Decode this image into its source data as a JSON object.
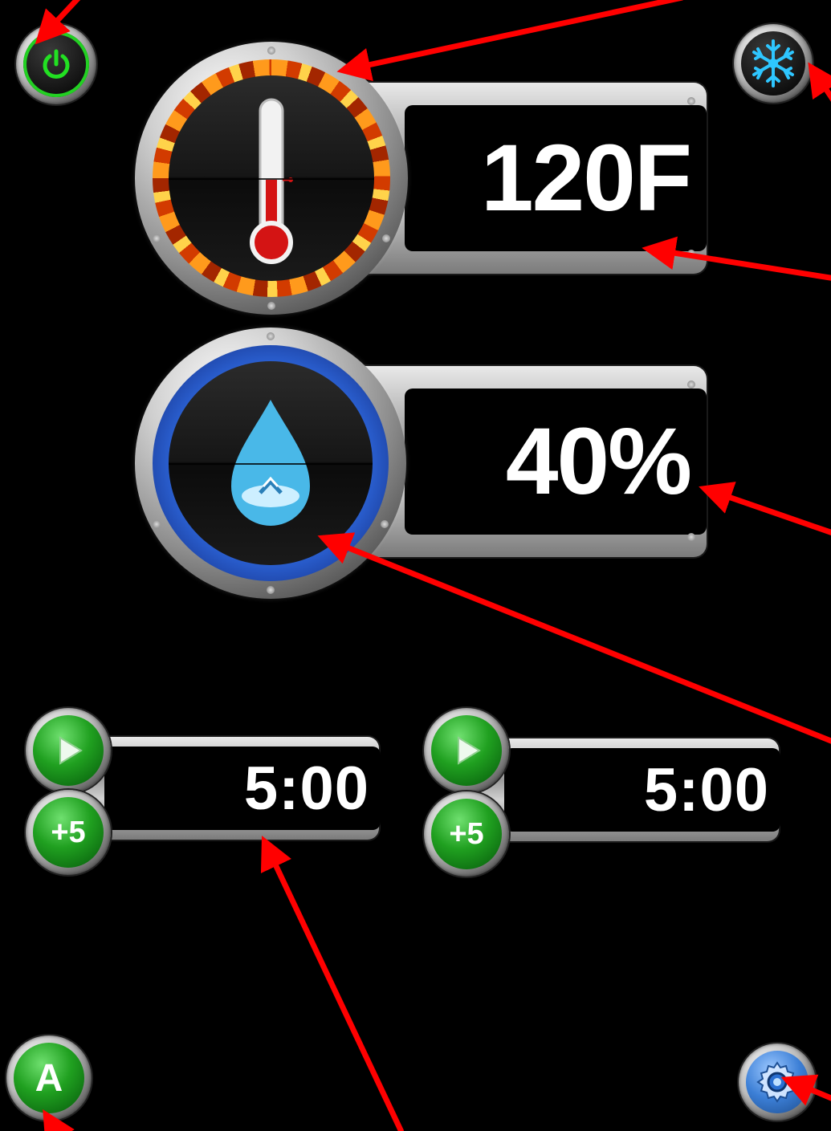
{
  "temperature": {
    "value": "120F"
  },
  "humidity": {
    "value": "40%"
  },
  "timers": [
    {
      "time": "5:00",
      "add_label": "+5"
    },
    {
      "time": "5:00",
      "add_label": "+5"
    }
  ],
  "auto_button": {
    "label": "A"
  },
  "icons": {
    "power": "power-icon",
    "cool": "snowflake-icon",
    "settings": "gear-icon",
    "thermometer": "thermometer-icon",
    "water": "water-drop-icon",
    "play": "play-icon"
  },
  "colors": {
    "background": "#000000",
    "annotation_arrow": "#ff0000",
    "green_button": "#20a020",
    "fire_ring": "#ff7a00",
    "water_ring": "#2a5fd0",
    "snowflake": "#2ec6ff"
  }
}
